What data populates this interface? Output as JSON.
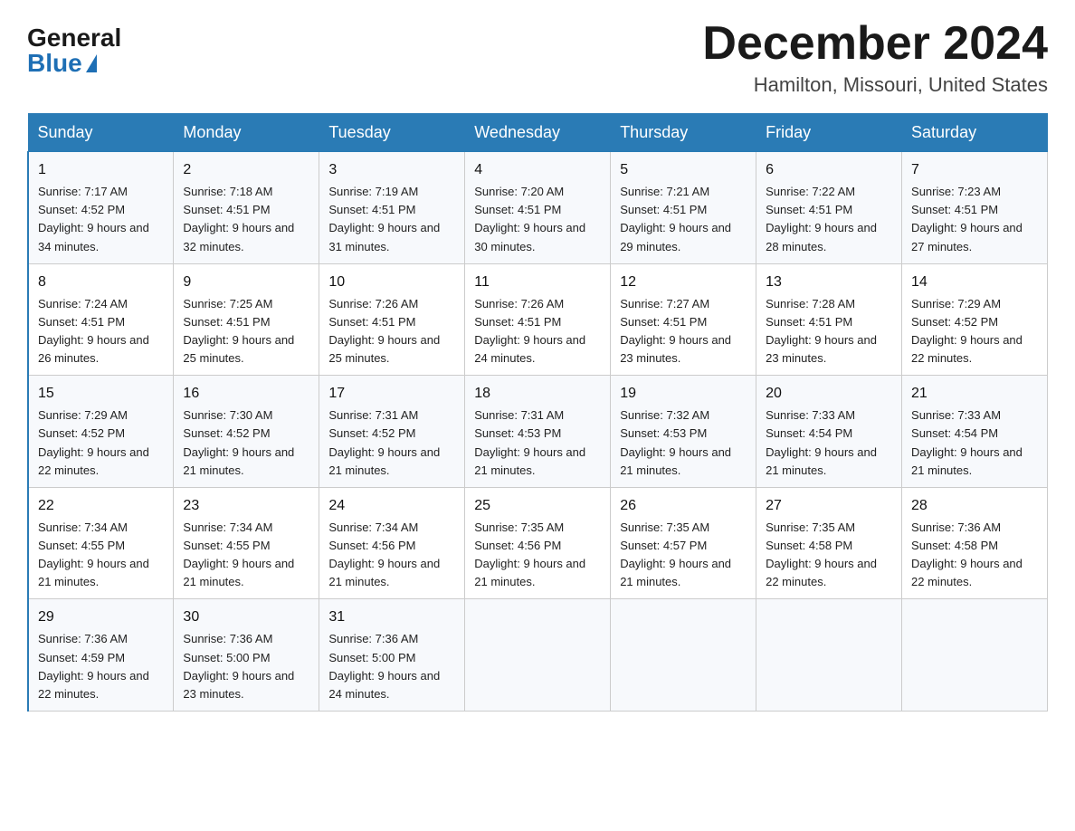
{
  "logo": {
    "general": "General",
    "blue": "Blue"
  },
  "title": "December 2024",
  "location": "Hamilton, Missouri, United States",
  "weekdays": [
    "Sunday",
    "Monday",
    "Tuesday",
    "Wednesday",
    "Thursday",
    "Friday",
    "Saturday"
  ],
  "weeks": [
    [
      {
        "day": "1",
        "sunrise": "7:17 AM",
        "sunset": "4:52 PM",
        "daylight": "9 hours and 34 minutes."
      },
      {
        "day": "2",
        "sunrise": "7:18 AM",
        "sunset": "4:51 PM",
        "daylight": "9 hours and 32 minutes."
      },
      {
        "day": "3",
        "sunrise": "7:19 AM",
        "sunset": "4:51 PM",
        "daylight": "9 hours and 31 minutes."
      },
      {
        "day": "4",
        "sunrise": "7:20 AM",
        "sunset": "4:51 PM",
        "daylight": "9 hours and 30 minutes."
      },
      {
        "day": "5",
        "sunrise": "7:21 AM",
        "sunset": "4:51 PM",
        "daylight": "9 hours and 29 minutes."
      },
      {
        "day": "6",
        "sunrise": "7:22 AM",
        "sunset": "4:51 PM",
        "daylight": "9 hours and 28 minutes."
      },
      {
        "day": "7",
        "sunrise": "7:23 AM",
        "sunset": "4:51 PM",
        "daylight": "9 hours and 27 minutes."
      }
    ],
    [
      {
        "day": "8",
        "sunrise": "7:24 AM",
        "sunset": "4:51 PM",
        "daylight": "9 hours and 26 minutes."
      },
      {
        "day": "9",
        "sunrise": "7:25 AM",
        "sunset": "4:51 PM",
        "daylight": "9 hours and 25 minutes."
      },
      {
        "day": "10",
        "sunrise": "7:26 AM",
        "sunset": "4:51 PM",
        "daylight": "9 hours and 25 minutes."
      },
      {
        "day": "11",
        "sunrise": "7:26 AM",
        "sunset": "4:51 PM",
        "daylight": "9 hours and 24 minutes."
      },
      {
        "day": "12",
        "sunrise": "7:27 AM",
        "sunset": "4:51 PM",
        "daylight": "9 hours and 23 minutes."
      },
      {
        "day": "13",
        "sunrise": "7:28 AM",
        "sunset": "4:51 PM",
        "daylight": "9 hours and 23 minutes."
      },
      {
        "day": "14",
        "sunrise": "7:29 AM",
        "sunset": "4:52 PM",
        "daylight": "9 hours and 22 minutes."
      }
    ],
    [
      {
        "day": "15",
        "sunrise": "7:29 AM",
        "sunset": "4:52 PM",
        "daylight": "9 hours and 22 minutes."
      },
      {
        "day": "16",
        "sunrise": "7:30 AM",
        "sunset": "4:52 PM",
        "daylight": "9 hours and 21 minutes."
      },
      {
        "day": "17",
        "sunrise": "7:31 AM",
        "sunset": "4:52 PM",
        "daylight": "9 hours and 21 minutes."
      },
      {
        "day": "18",
        "sunrise": "7:31 AM",
        "sunset": "4:53 PM",
        "daylight": "9 hours and 21 minutes."
      },
      {
        "day": "19",
        "sunrise": "7:32 AM",
        "sunset": "4:53 PM",
        "daylight": "9 hours and 21 minutes."
      },
      {
        "day": "20",
        "sunrise": "7:33 AM",
        "sunset": "4:54 PM",
        "daylight": "9 hours and 21 minutes."
      },
      {
        "day": "21",
        "sunrise": "7:33 AM",
        "sunset": "4:54 PM",
        "daylight": "9 hours and 21 minutes."
      }
    ],
    [
      {
        "day": "22",
        "sunrise": "7:34 AM",
        "sunset": "4:55 PM",
        "daylight": "9 hours and 21 minutes."
      },
      {
        "day": "23",
        "sunrise": "7:34 AM",
        "sunset": "4:55 PM",
        "daylight": "9 hours and 21 minutes."
      },
      {
        "day": "24",
        "sunrise": "7:34 AM",
        "sunset": "4:56 PM",
        "daylight": "9 hours and 21 minutes."
      },
      {
        "day": "25",
        "sunrise": "7:35 AM",
        "sunset": "4:56 PM",
        "daylight": "9 hours and 21 minutes."
      },
      {
        "day": "26",
        "sunrise": "7:35 AM",
        "sunset": "4:57 PM",
        "daylight": "9 hours and 21 minutes."
      },
      {
        "day": "27",
        "sunrise": "7:35 AM",
        "sunset": "4:58 PM",
        "daylight": "9 hours and 22 minutes."
      },
      {
        "day": "28",
        "sunrise": "7:36 AM",
        "sunset": "4:58 PM",
        "daylight": "9 hours and 22 minutes."
      }
    ],
    [
      {
        "day": "29",
        "sunrise": "7:36 AM",
        "sunset": "4:59 PM",
        "daylight": "9 hours and 22 minutes."
      },
      {
        "day": "30",
        "sunrise": "7:36 AM",
        "sunset": "5:00 PM",
        "daylight": "9 hours and 23 minutes."
      },
      {
        "day": "31",
        "sunrise": "7:36 AM",
        "sunset": "5:00 PM",
        "daylight": "9 hours and 24 minutes."
      },
      null,
      null,
      null,
      null
    ]
  ]
}
